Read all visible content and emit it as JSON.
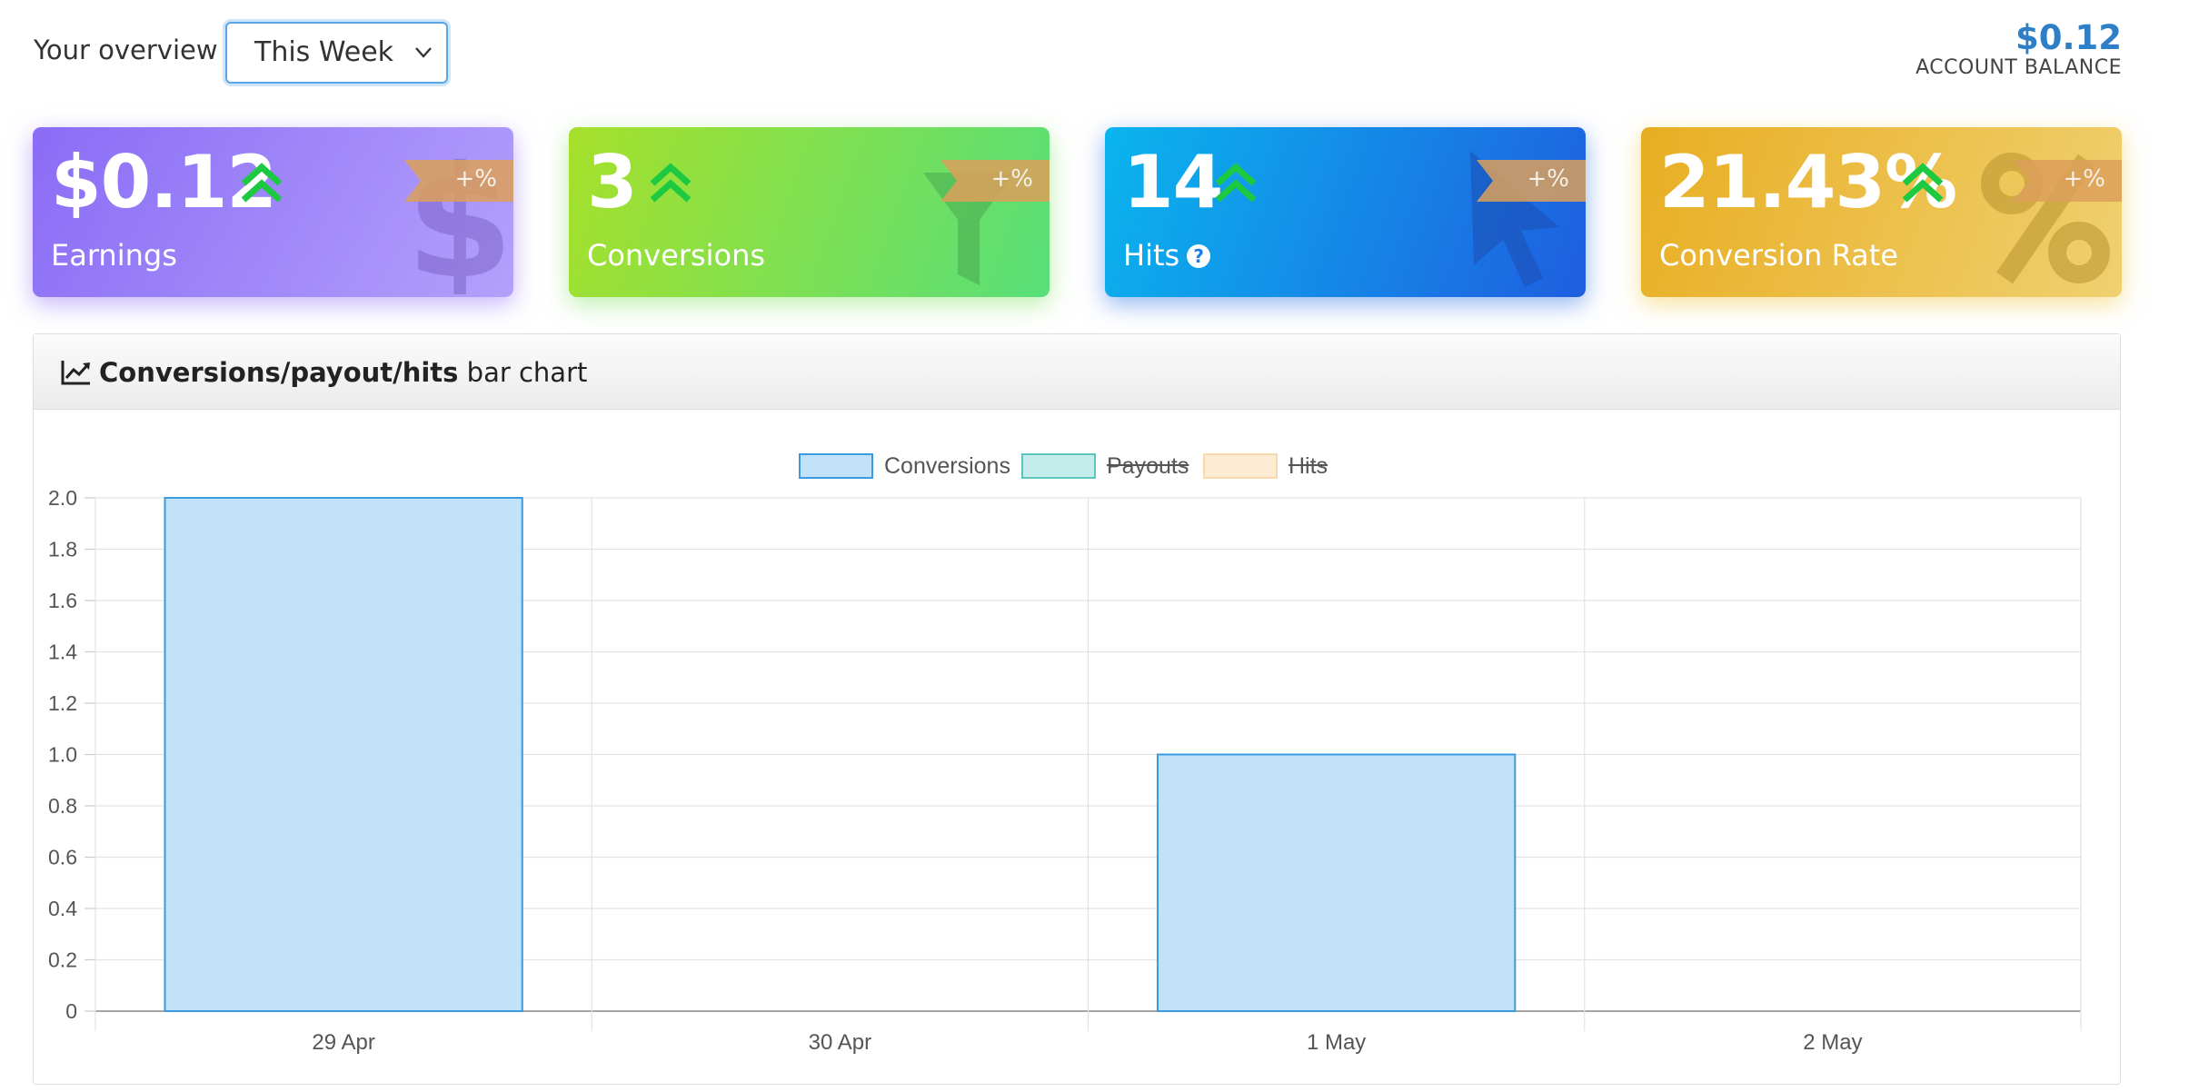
{
  "header": {
    "overview_label": "Your overview",
    "period_selected": "This Week",
    "balance_value": "$0.12",
    "balance_label": "ACCOUNT BALANCE"
  },
  "cards": [
    {
      "value": "$0.12",
      "label": "Earnings",
      "badge": "+%",
      "icon": "dollar-icon"
    },
    {
      "value": "3",
      "label": "Conversions",
      "badge": "+%",
      "icon": "funnel-icon"
    },
    {
      "value": "14",
      "label": "Hits",
      "badge": "+%",
      "icon": "cursor-icon",
      "help_icon": "question-circle-icon"
    },
    {
      "value": "21.43%",
      "label": "Conversion Rate",
      "badge": "+%",
      "icon": "percent-icon"
    }
  ],
  "panel": {
    "title_bold": "Conversions/payout/hits",
    "title_rest": "bar chart",
    "icon": "line-chart-icon"
  },
  "colors": {
    "conversions": "#c3e2f7",
    "conversions_border": "#3b9be0",
    "payouts": "#c4ecea",
    "payouts_border": "#5cc5bd",
    "hits": "#fdebd4",
    "hits_border": "#f8d9ae",
    "trend_up": "#1cc940"
  },
  "chart_data": {
    "type": "bar",
    "categories": [
      "29 Apr",
      "30 Apr",
      "1 May",
      "2 May"
    ],
    "series": [
      {
        "name": "Conversions",
        "values": [
          2,
          0,
          1,
          0
        ],
        "hidden": false
      },
      {
        "name": "Payouts",
        "values": [],
        "hidden": true
      },
      {
        "name": "Hits",
        "values": [],
        "hidden": true
      }
    ],
    "ylim": [
      0,
      2.0
    ],
    "yticks": [
      "0",
      "0.2",
      "0.4",
      "0.6",
      "0.8",
      "1.0",
      "1.2",
      "1.4",
      "1.6",
      "1.8",
      "2.0"
    ],
    "legend_position": "top-center",
    "grid": true
  }
}
